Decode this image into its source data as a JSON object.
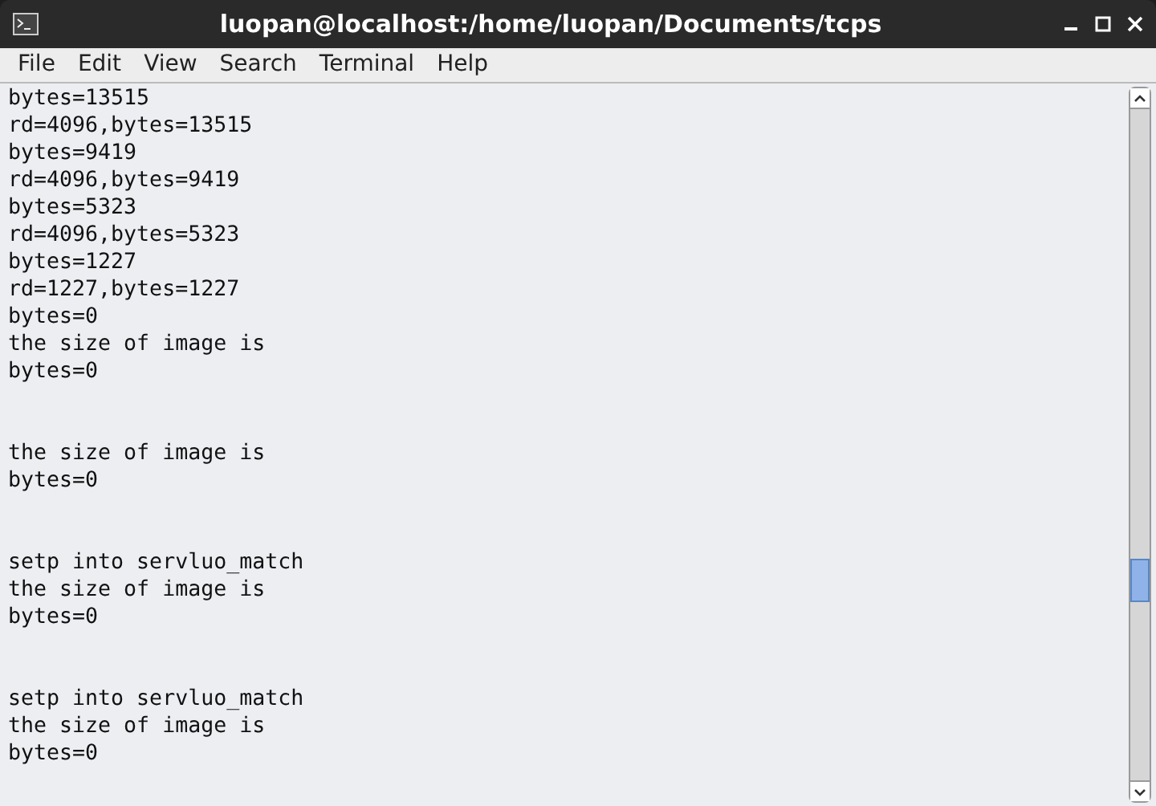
{
  "window": {
    "title": "luopan@localhost:/home/luopan/Documents/tcps"
  },
  "menu": [
    "File",
    "Edit",
    "View",
    "Search",
    "Terminal",
    "Help"
  ],
  "terminal": {
    "blocks": [
      [
        "bytes=13515",
        "rd=4096,bytes=13515",
        "bytes=9419",
        "rd=4096,bytes=9419",
        "bytes=5323",
        "rd=4096,bytes=5323",
        "bytes=1227",
        "rd=1227,bytes=1227",
        "bytes=0",
        "the size of image is",
        "bytes=0"
      ],
      [
        "the size of image is",
        "bytes=0"
      ],
      [
        "setp into servluo_match",
        "the size of image is",
        "bytes=0"
      ],
      [
        "setp into servluo_match",
        "the size of image is",
        "bytes=0"
      ]
    ]
  }
}
